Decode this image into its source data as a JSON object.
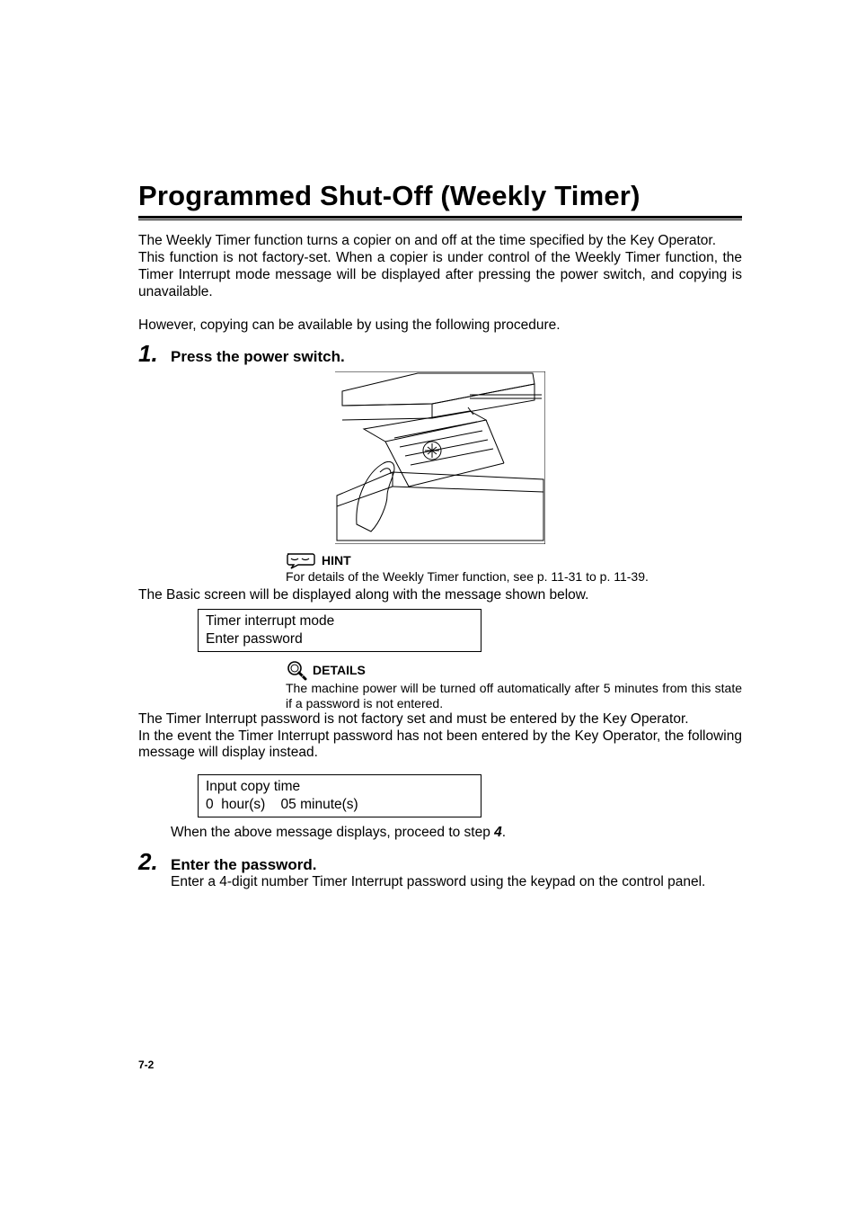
{
  "title": "Programmed Shut-Off (Weekly Timer)",
  "intro": {
    "p1a": "The Weekly Timer function turns a copier on and off at the time specified by the Key Operator.",
    "p1b": "This function is not factory-set. When a copier is under control of the Weekly Timer function, the Timer Interrupt mode message will be displayed after pressing the power switch, and copying is unavailable.",
    "p2": "However, copying can be available by using the following procedure."
  },
  "steps": [
    {
      "num": "1.",
      "heading": "Press the power switch.",
      "hint_label": "HINT",
      "hint_text": "For details of the Weekly Timer function, see p. 11-31 to p. 11-39.",
      "after_hint": "The Basic screen will be displayed along with the message shown below.",
      "display1": {
        "line1": "Timer interrupt mode",
        "line2": "Enter password"
      },
      "details_label": "DETAILS",
      "details_text": "The machine power will be turned off automatically after 5 minutes from this state if a password is not entered.",
      "after_details1": "The Timer Interrupt password is not factory set and must be entered by the Key Operator.",
      "after_details2": "In the event the Timer Interrupt password has not been entered by the Key Operator, the following message will display instead.",
      "display2": {
        "line1": "Input copy time",
        "line2": "0  hour(s)    05 minute(s)"
      },
      "proceed": "When the above message displays, proceed to step 4."
    },
    {
      "num": "2.",
      "heading": "Enter the password.",
      "body": "Enter a 4-digit number Timer Interrupt password using the keypad on the control panel."
    }
  ],
  "page_number": "7-2",
  "icons": {
    "hint": "hint-bubble-icon",
    "details": "magnifier-icon"
  }
}
